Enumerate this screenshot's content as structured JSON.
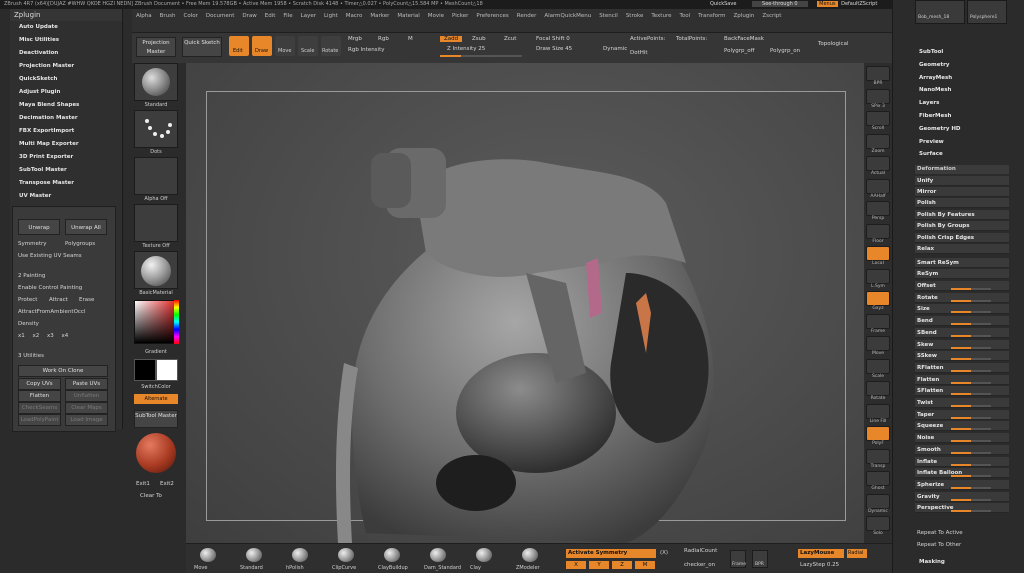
{
  "titlebar": {
    "text": "ZBrush 4R7 (x64)[DUJAZ #WHW QKOE HGZI NEDN]   ZBrush Document     • Free Mem 19.578GB • Active Mem 1958 • Scratch Disk 4148 • Timer△0.027 • PolyCount△15.584 MP • MeshCount△18"
  },
  "top_right": {
    "quicksave": "QuickSave",
    "see_through": "See-through 0",
    "menus": "Menus",
    "default_script": "DefaultZScript"
  },
  "menu": [
    "Alpha",
    "Brush",
    "Color",
    "Document",
    "Draw",
    "Edit",
    "File",
    "Layer",
    "Light",
    "Macro",
    "Marker",
    "Material",
    "Movie",
    "Picker",
    "Preferences",
    "Render",
    "AlarmQuickMenu",
    "Stencil",
    "Stroke",
    "Texture",
    "Tool",
    "Transform",
    "Zplugin",
    "Zscript"
  ],
  "leftpanel": {
    "title": "Zplugin",
    "items": [
      "Auto Update",
      "Misc Utilities",
      "Deactivation",
      "Projection Master",
      "QuickSketch",
      "Adjust Plugin",
      "Maya Blend Shapes",
      "Decimation Master",
      "FBX ExportImport",
      "Multi Map Exporter",
      "3D Print Exporter",
      "SubTool Master",
      "Transpose Master",
      "UV Master"
    ],
    "uv": {
      "unwrap": "Unwrap",
      "unwrap_all": "Unwrap All",
      "symmetry": "Symmetry",
      "polygroups": "Polygroups",
      "use_existing": "Use Existing UV Seams"
    },
    "painting": {
      "title": "2 Painting",
      "enable": "Enable Control Painting",
      "protect": "Protect",
      "attract": "Attract",
      "erase": "Erase",
      "attract_ambient": "AttractFromAmbientOccl",
      "density": "Density",
      "vals": [
        "x1",
        "x2",
        "x3",
        "x4"
      ]
    },
    "utilities": {
      "title": "3 Utilities",
      "work_on_clone": "Work On Clone",
      "copy_uvs": "Copy UVs",
      "paste_uvs": "Paste UVs",
      "flatten": "Flatten",
      "unflatten": "Unflatten",
      "check_seams": "CheckSeams",
      "clear_maps": "Clear Maps",
      "load_polypaint": "LoadPolyPaint",
      "load_image": "Load Image"
    }
  },
  "toolbar": {
    "projection_master": "Projection Master",
    "quick_sketch": "Quick Sketch",
    "edit": "Edit",
    "draw": "Draw",
    "move": "Move",
    "scale": "Scale",
    "rotate": "Rotate",
    "mrgb": "Mrgb",
    "rgb": "Rgb",
    "m": "M",
    "rgb_intensity": "Rgb Intensity",
    "zadd": "Zadd",
    "zsub": "Zsub",
    "zcut": "Zcut",
    "z_intensity": "Z Intensity 25",
    "focal_shift": "Focal Shift 0",
    "draw_size": "Draw Size 45",
    "dynamic": "Dynamic",
    "active_points": "ActivePoints:",
    "total_points": "TotalPoints:",
    "dothit": "DotHit",
    "backface": "BackFaceMask",
    "polygrp_off": "Polygrp_off",
    "polygrp_on": "Polygrp_on",
    "topological": "Topological"
  },
  "shelf": {
    "labels": [
      "Standard",
      "Dots",
      "Alpha Off",
      "Texture Off",
      "BasicMaterial"
    ],
    "gradient": "Gradient",
    "switch_color": "SwitchColor",
    "alternate": "Alternate",
    "subtool_master": "SubTool Master",
    "exit1": "Exit1",
    "exit2": "Exit2",
    "clear_to": "Clear To"
  },
  "rightstrip": [
    "BPR",
    "SPix 3",
    "Scroll",
    "Zoom",
    "Actual",
    "AAHalf",
    "Persp",
    "Floor",
    "Local",
    "L.Sym",
    "Gxyz",
    "Frame",
    "Move",
    "Scale",
    "Rotate",
    "Line Fill",
    "PolyF",
    "Transp",
    "Ghost",
    "Dynamic",
    "Solo"
  ],
  "rightpanel": {
    "top": {
      "thumb1": "Bob_mesh_18",
      "thumb2": "Polysphere1"
    },
    "menus": [
      "SubTool",
      "Geometry",
      "ArrayMesh",
      "NanoMesh",
      "Layers",
      "FiberMesh",
      "Geometry HD",
      "Preview",
      "Surface"
    ],
    "deformation_title": "Deformation",
    "unify": "Unify",
    "mirror": "Mirror",
    "rows": [
      "Polish",
      "Polish By Features",
      "Polish By Groups",
      "Polish Crisp Edges",
      "Relax"
    ],
    "smart_resym": "Smart ReSym",
    "resym": "ReSym",
    "sliders": [
      "Offset",
      "Rotate",
      "Size",
      "Bend",
      "SBend",
      "Skew",
      "SSkew",
      "RFlatten",
      "Flatten",
      "SFlatten",
      "Twist",
      "Taper",
      "Squeeze",
      "Noise",
      "Smooth",
      "Inflate",
      "Inflate Balloon",
      "Spherize",
      "Gravity",
      "Perspective"
    ],
    "repeat_active": "Repeat To Active",
    "repeat_other": "Repeat To Other",
    "masking": "Masking"
  },
  "bottombar": {
    "brushes": [
      "Move",
      "Standard",
      "hPolish",
      "ClipCurve",
      "ClayBuildup",
      "Dam_Standard",
      "Clay",
      "ZModeler"
    ],
    "activate_symmetry": "Activate Symmetry",
    "x": "(X)",
    "axes": [
      "X",
      "Y",
      "Z",
      "M"
    ],
    "radial_count": "RadialCount",
    "checker": "checker_on",
    "frame": "Frame",
    "bpr": "BPR",
    "lazymouse": "LazyMouse",
    "lazystep": "LazyStep 0.25",
    "radial": "Radial"
  },
  "colors": {
    "accent": "#e8862a",
    "panel": "#2f2f2f",
    "viewport": "#4f4f4f"
  }
}
